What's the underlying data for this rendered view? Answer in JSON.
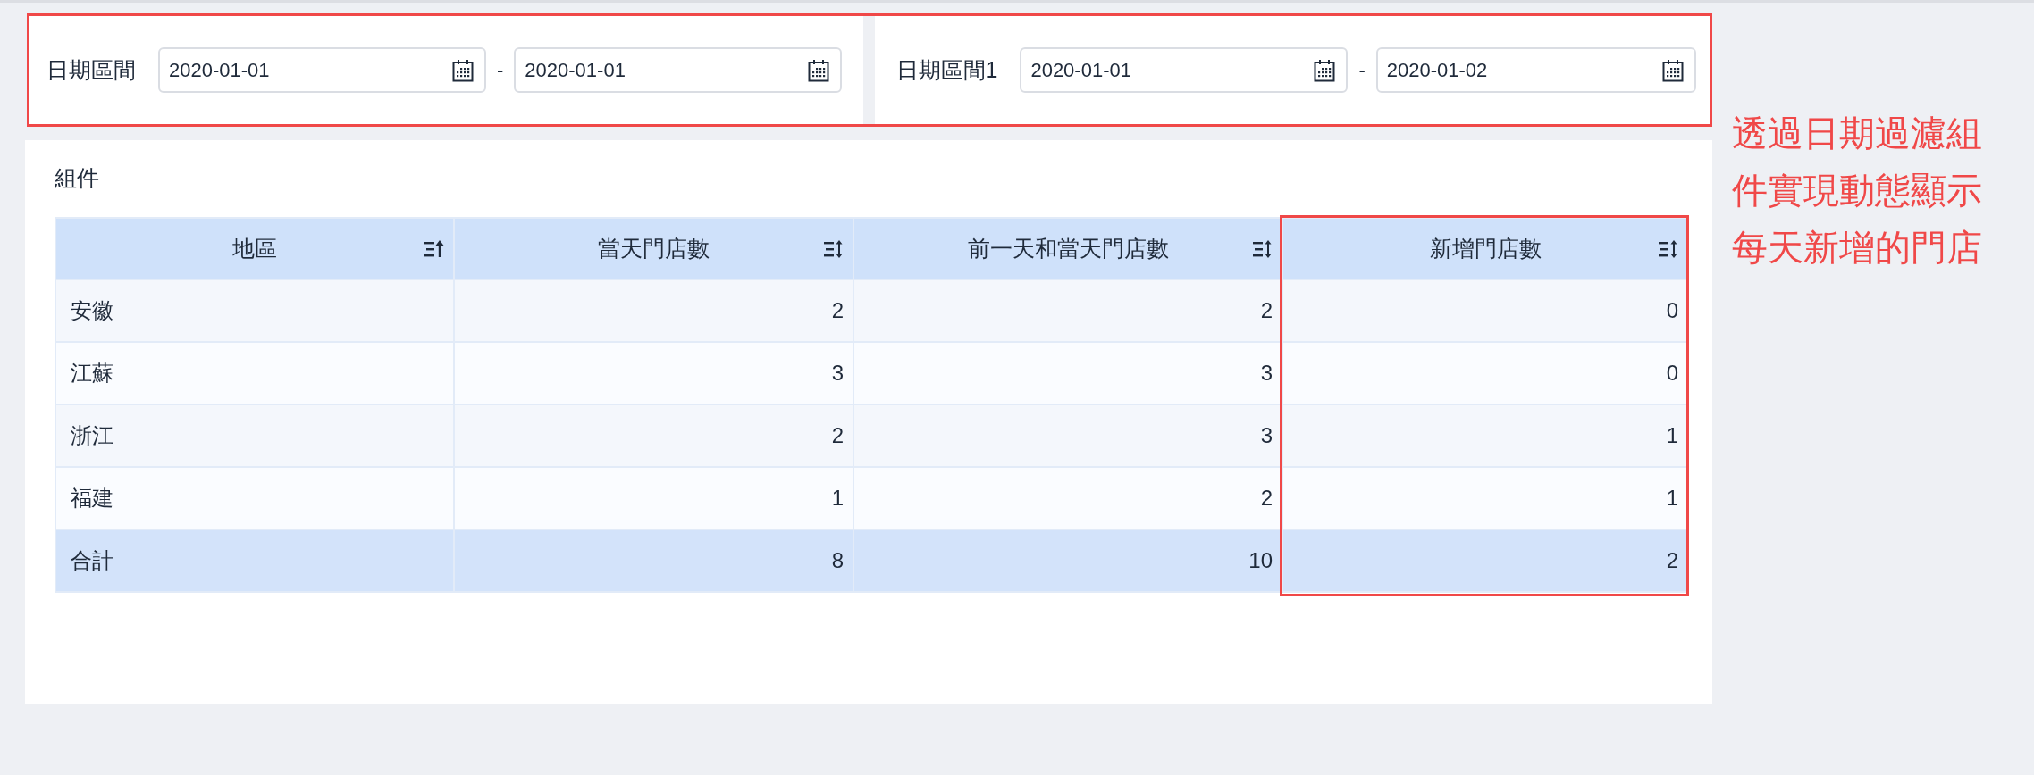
{
  "filters": {
    "highlighted": true,
    "groups": [
      {
        "label": "日期區間",
        "start": "2020-01-01",
        "separator": "-",
        "end": "2020-01-01"
      },
      {
        "label": "日期區間1",
        "start": "2020-01-01",
        "separator": "-",
        "end": "2020-01-02"
      }
    ]
  },
  "widget": {
    "title": "組件",
    "table": {
      "columns": [
        {
          "label": "地區",
          "sorted_ascending": true,
          "highlighted": false
        },
        {
          "label": "當天門店數",
          "sorted_ascending": false,
          "highlighted": false
        },
        {
          "label": "前一天和當天門店數",
          "sorted_ascending": false,
          "highlighted": false
        },
        {
          "label": "新增門店數",
          "sorted_ascending": false,
          "highlighted": true
        }
      ],
      "rows": [
        {
          "kind": "data",
          "cells": [
            "安徽",
            "2",
            "2",
            "0"
          ]
        },
        {
          "kind": "data",
          "cells": [
            "江蘇",
            "3",
            "3",
            "0"
          ]
        },
        {
          "kind": "data",
          "cells": [
            "浙江",
            "2",
            "3",
            "1"
          ]
        },
        {
          "kind": "data",
          "cells": [
            "福建",
            "1",
            "2",
            "1"
          ]
        },
        {
          "kind": "total",
          "cells": [
            "合計",
            "8",
            "10",
            "2"
          ]
        }
      ]
    }
  },
  "annotation": {
    "text": "透過日期過濾組件實現動態顯示每天新增的門店"
  }
}
